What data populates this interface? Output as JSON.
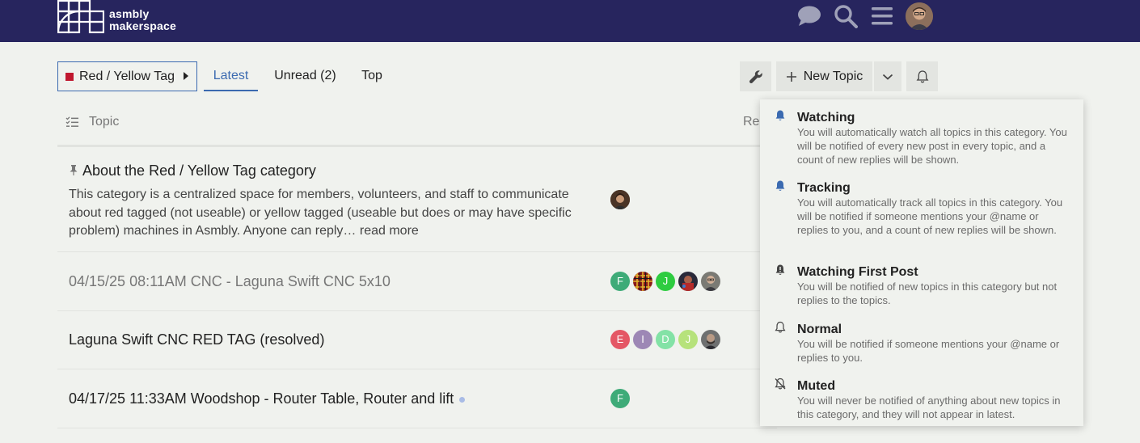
{
  "header": {
    "logo_line1": "asmbly",
    "logo_line2": "makerspace",
    "icons": [
      "chat-icon",
      "search-icon",
      "hamburger-menu-icon"
    ]
  },
  "nav": {
    "category": "Red / Yellow Tag",
    "category_color": "#c0182f",
    "tabs": [
      "Latest",
      "Unread (2)",
      "Top"
    ],
    "active_tab": "Latest",
    "new_topic": "New Topic"
  },
  "list": {
    "topic_header": "Topic",
    "replies_header_partial": "Re"
  },
  "topics": [
    {
      "title": "About the Red / Yellow Tag category",
      "pinned": true,
      "excerpt": "This category is a centralized space for members, volunteers, and staff to communicate about red tagged (not useable) or yellow tagged (useable but does or may have specific problem) machines in Asmbly. Anyone can reply…",
      "read_more": "read more"
    },
    {
      "title": "04/15/25 08:11AM CNC - Laguna Swift CNC 5x10",
      "visited": true,
      "posters": [
        "F",
        "",
        "J",
        "",
        ""
      ]
    },
    {
      "title": "Laguna Swift CNC RED TAG (resolved)",
      "posters": [
        "E",
        "I",
        "D",
        "J",
        ""
      ]
    },
    {
      "title": "04/17/25 11:33AM Woodshop - Router Table, Router and lift",
      "posters": [
        "F"
      ],
      "unread": true
    }
  ],
  "notification_menu": [
    {
      "title": "Watching",
      "icon": "bell-icon",
      "description": "You will automatically watch all topics in this category. You will be notified of every new post in every topic, and a count of new replies will be shown."
    },
    {
      "title": "Tracking",
      "icon": "bell-icon",
      "description": "You will automatically track all topics in this category. You will be notified if someone mentions your @name or replies to you, and a count of new replies will be shown."
    },
    {
      "title": "Watching First Post",
      "icon": "bell-exclamation-icon",
      "description": "You will be notified of new topics in this category but not replies to the topics."
    },
    {
      "title": "Normal",
      "icon": "bell-outline-icon",
      "description": "You will be notified if someone mentions your @name or replies to you."
    },
    {
      "title": "Muted",
      "icon": "bell-slash-icon",
      "description": "You will never be notified of anything about new topics in this category, and they will not appear in latest."
    }
  ]
}
